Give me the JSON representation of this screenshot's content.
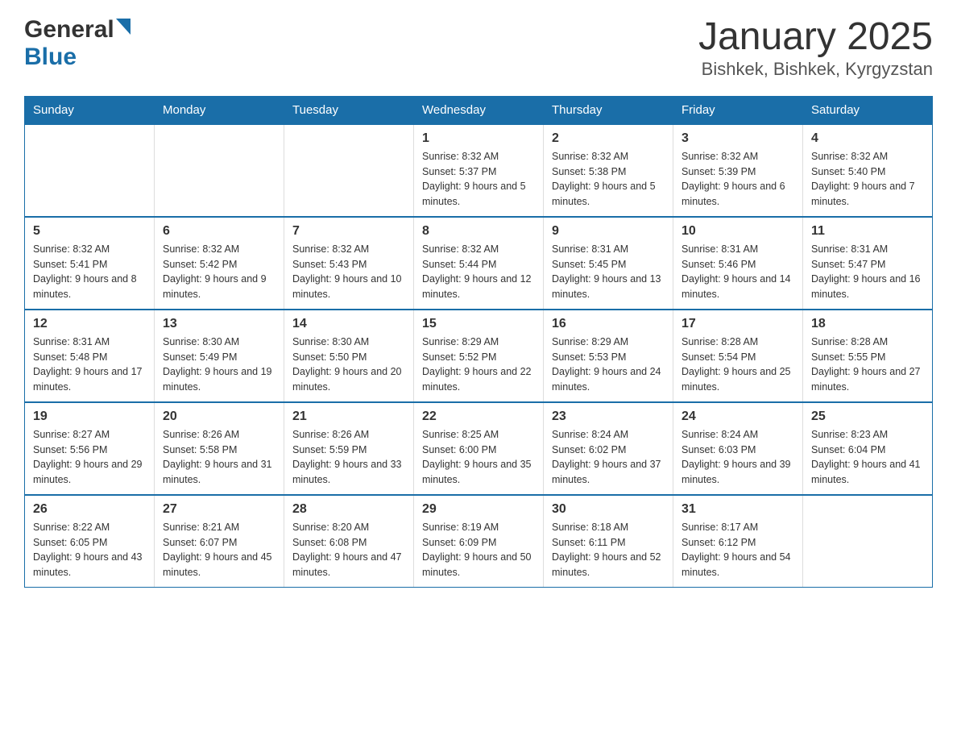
{
  "header": {
    "logo_general": "General",
    "logo_blue": "Blue",
    "month_title": "January 2025",
    "location": "Bishkek, Bishkek, Kyrgyzstan"
  },
  "days_of_week": [
    "Sunday",
    "Monday",
    "Tuesday",
    "Wednesday",
    "Thursday",
    "Friday",
    "Saturday"
  ],
  "weeks": [
    [
      {
        "day": "",
        "info": ""
      },
      {
        "day": "",
        "info": ""
      },
      {
        "day": "",
        "info": ""
      },
      {
        "day": "1",
        "info": "Sunrise: 8:32 AM\nSunset: 5:37 PM\nDaylight: 9 hours and 5 minutes."
      },
      {
        "day": "2",
        "info": "Sunrise: 8:32 AM\nSunset: 5:38 PM\nDaylight: 9 hours and 5 minutes."
      },
      {
        "day": "3",
        "info": "Sunrise: 8:32 AM\nSunset: 5:39 PM\nDaylight: 9 hours and 6 minutes."
      },
      {
        "day": "4",
        "info": "Sunrise: 8:32 AM\nSunset: 5:40 PM\nDaylight: 9 hours and 7 minutes."
      }
    ],
    [
      {
        "day": "5",
        "info": "Sunrise: 8:32 AM\nSunset: 5:41 PM\nDaylight: 9 hours and 8 minutes."
      },
      {
        "day": "6",
        "info": "Sunrise: 8:32 AM\nSunset: 5:42 PM\nDaylight: 9 hours and 9 minutes."
      },
      {
        "day": "7",
        "info": "Sunrise: 8:32 AM\nSunset: 5:43 PM\nDaylight: 9 hours and 10 minutes."
      },
      {
        "day": "8",
        "info": "Sunrise: 8:32 AM\nSunset: 5:44 PM\nDaylight: 9 hours and 12 minutes."
      },
      {
        "day": "9",
        "info": "Sunrise: 8:31 AM\nSunset: 5:45 PM\nDaylight: 9 hours and 13 minutes."
      },
      {
        "day": "10",
        "info": "Sunrise: 8:31 AM\nSunset: 5:46 PM\nDaylight: 9 hours and 14 minutes."
      },
      {
        "day": "11",
        "info": "Sunrise: 8:31 AM\nSunset: 5:47 PM\nDaylight: 9 hours and 16 minutes."
      }
    ],
    [
      {
        "day": "12",
        "info": "Sunrise: 8:31 AM\nSunset: 5:48 PM\nDaylight: 9 hours and 17 minutes."
      },
      {
        "day": "13",
        "info": "Sunrise: 8:30 AM\nSunset: 5:49 PM\nDaylight: 9 hours and 19 minutes."
      },
      {
        "day": "14",
        "info": "Sunrise: 8:30 AM\nSunset: 5:50 PM\nDaylight: 9 hours and 20 minutes."
      },
      {
        "day": "15",
        "info": "Sunrise: 8:29 AM\nSunset: 5:52 PM\nDaylight: 9 hours and 22 minutes."
      },
      {
        "day": "16",
        "info": "Sunrise: 8:29 AM\nSunset: 5:53 PM\nDaylight: 9 hours and 24 minutes."
      },
      {
        "day": "17",
        "info": "Sunrise: 8:28 AM\nSunset: 5:54 PM\nDaylight: 9 hours and 25 minutes."
      },
      {
        "day": "18",
        "info": "Sunrise: 8:28 AM\nSunset: 5:55 PM\nDaylight: 9 hours and 27 minutes."
      }
    ],
    [
      {
        "day": "19",
        "info": "Sunrise: 8:27 AM\nSunset: 5:56 PM\nDaylight: 9 hours and 29 minutes."
      },
      {
        "day": "20",
        "info": "Sunrise: 8:26 AM\nSunset: 5:58 PM\nDaylight: 9 hours and 31 minutes."
      },
      {
        "day": "21",
        "info": "Sunrise: 8:26 AM\nSunset: 5:59 PM\nDaylight: 9 hours and 33 minutes."
      },
      {
        "day": "22",
        "info": "Sunrise: 8:25 AM\nSunset: 6:00 PM\nDaylight: 9 hours and 35 minutes."
      },
      {
        "day": "23",
        "info": "Sunrise: 8:24 AM\nSunset: 6:02 PM\nDaylight: 9 hours and 37 minutes."
      },
      {
        "day": "24",
        "info": "Sunrise: 8:24 AM\nSunset: 6:03 PM\nDaylight: 9 hours and 39 minutes."
      },
      {
        "day": "25",
        "info": "Sunrise: 8:23 AM\nSunset: 6:04 PM\nDaylight: 9 hours and 41 minutes."
      }
    ],
    [
      {
        "day": "26",
        "info": "Sunrise: 8:22 AM\nSunset: 6:05 PM\nDaylight: 9 hours and 43 minutes."
      },
      {
        "day": "27",
        "info": "Sunrise: 8:21 AM\nSunset: 6:07 PM\nDaylight: 9 hours and 45 minutes."
      },
      {
        "day": "28",
        "info": "Sunrise: 8:20 AM\nSunset: 6:08 PM\nDaylight: 9 hours and 47 minutes."
      },
      {
        "day": "29",
        "info": "Sunrise: 8:19 AM\nSunset: 6:09 PM\nDaylight: 9 hours and 50 minutes."
      },
      {
        "day": "30",
        "info": "Sunrise: 8:18 AM\nSunset: 6:11 PM\nDaylight: 9 hours and 52 minutes."
      },
      {
        "day": "31",
        "info": "Sunrise: 8:17 AM\nSunset: 6:12 PM\nDaylight: 9 hours and 54 minutes."
      },
      {
        "day": "",
        "info": ""
      }
    ]
  ]
}
